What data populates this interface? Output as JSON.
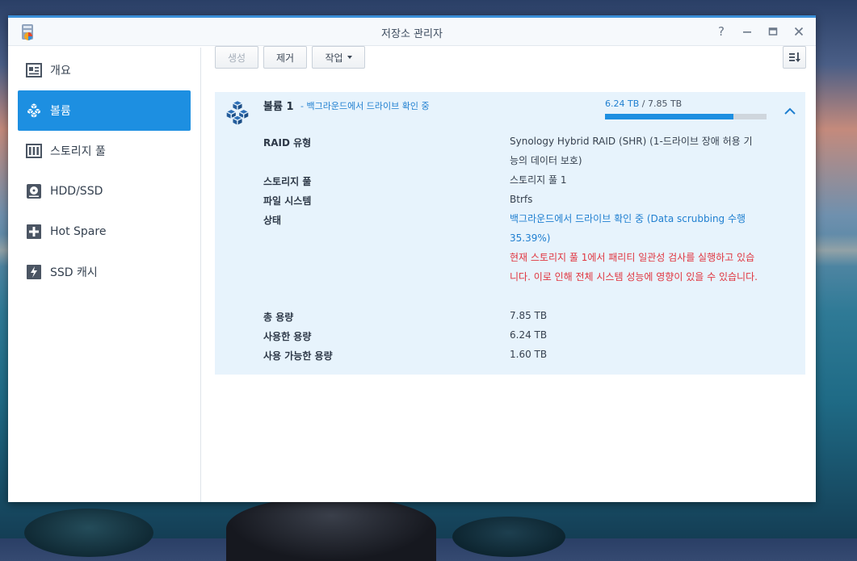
{
  "window": {
    "title": "저장소 관리자"
  },
  "sidebar": {
    "items": [
      {
        "label": "개요",
        "icon": "overview-icon",
        "active": false
      },
      {
        "label": "볼륨",
        "icon": "volume-cubes-icon",
        "active": true
      },
      {
        "label": "스토리지 풀",
        "icon": "storage-pool-icon",
        "active": false
      },
      {
        "label": "HDD/SSD",
        "icon": "hdd-icon",
        "active": false
      },
      {
        "label": "Hot Spare",
        "icon": "hot-spare-icon",
        "active": false
      },
      {
        "label": "SSD 캐시",
        "icon": "ssd-cache-icon",
        "active": false
      }
    ]
  },
  "toolbar": {
    "create_label": "생성",
    "remove_label": "제거",
    "action_label": "작업"
  },
  "volume": {
    "title": "볼륨 1",
    "status_summary": "- 백그라운드에서 드라이브 확인 중",
    "used": "6.24 TB",
    "separator": " / ",
    "total": "7.85 TB",
    "usage_fraction": 0.795
  },
  "details": {
    "raid_label": "RAID 유형",
    "raid_value": "Synology Hybrid RAID (SHR) (1-드라이브 장애 허용 기능의 데이터 보호)",
    "pool_label": "스토리지 풀",
    "pool_value": "스토리지 풀 1",
    "fs_label": "파일 시스템",
    "fs_value": "Btrfs",
    "status_label": "상태",
    "status_value": "백그라운드에서 드라이브 확인 중 (",
    "status_scrub": "Data scrubbing 수행 35.39%",
    "status_end": ")",
    "status_warning": "현재 스토리지 풀 1에서 패리티 일관성 검사를 실행하고 있습니다. 이로 인해 전체 시스템 성능에 영향이 있을 수 있습니다.",
    "total_label": "총 용량",
    "total_value": "7.85 TB",
    "used_label": "사용한 용량",
    "used_value": "6.24 TB",
    "avail_label": "사용 가능한 용량",
    "avail_value": "1.60 TB"
  },
  "colors": {
    "accent": "#1d8fe1",
    "panel": "#e7f3fc",
    "warning": "#e0353f"
  }
}
